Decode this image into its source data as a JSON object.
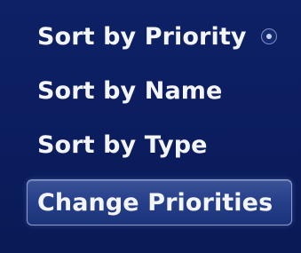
{
  "menu": {
    "items": [
      {
        "label": "Sort by Priority",
        "selected": true
      },
      {
        "label": "Sort by Name",
        "selected": false
      },
      {
        "label": "Sort by Type",
        "selected": false
      },
      {
        "label": "Change Priorities",
        "focused": true
      }
    ],
    "selected_indicator_icon": "radio-selected-icon"
  },
  "colors": {
    "background": "#0c1e62",
    "text": "#f3f5fb",
    "focus_fill": "#26408a",
    "focus_border": "#8d9cc9"
  }
}
